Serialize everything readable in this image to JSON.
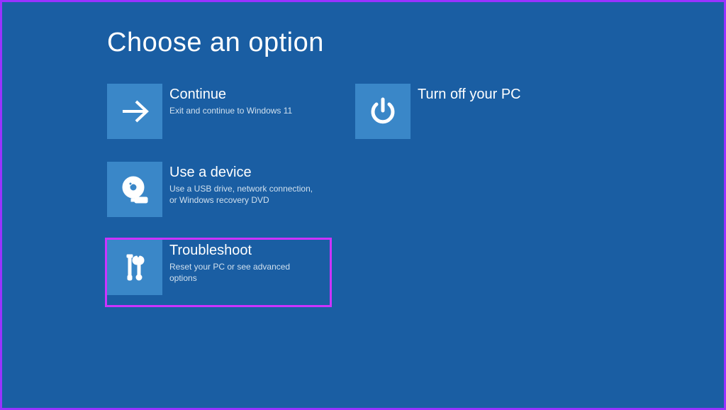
{
  "title": "Choose an option",
  "col1": [
    {
      "title": "Continue",
      "desc": "Exit and continue to Windows 11"
    },
    {
      "title": "Use a device",
      "desc": "Use a USB drive, network connection, or Windows recovery DVD"
    },
    {
      "title": "Troubleshoot",
      "desc": "Reset your PC or see advanced options"
    }
  ],
  "col2": [
    {
      "title": "Turn off your PC",
      "desc": ""
    }
  ]
}
